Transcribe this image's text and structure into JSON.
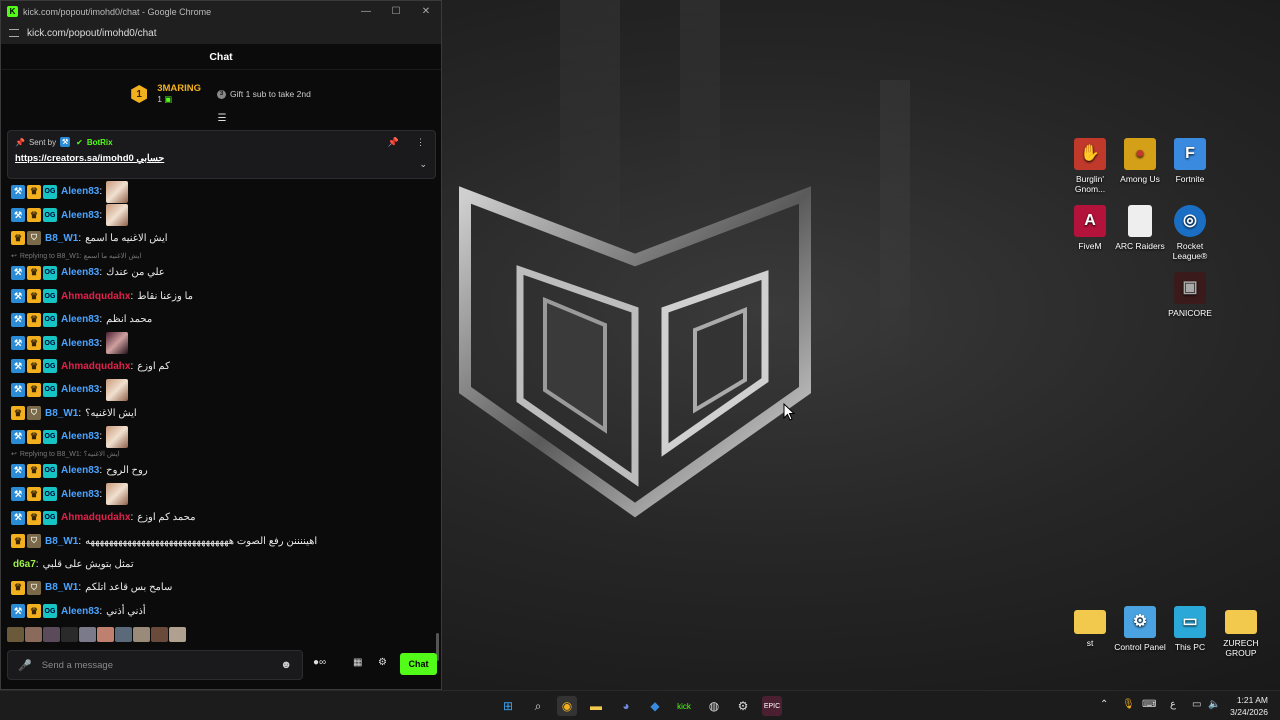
{
  "window": {
    "title": "kick.com/popout/imohd0/chat - Google Chrome",
    "url": "kick.com/popout/imohd0/chat",
    "minimize": "—",
    "maximize": "☐",
    "close": "✕"
  },
  "chat": {
    "header": "Chat",
    "leaderboard": {
      "rank": "1",
      "name": "3MARING",
      "count": "1",
      "gift_text": "Gift 1 sub to take 2nd"
    },
    "pinned": {
      "sent_by": "Sent by",
      "bot_name": "BotRix",
      "link": "https://creators.sa/imohd0 حسابي"
    },
    "messages": [
      {
        "user": "Aleen83",
        "color": "blue",
        "badges": [
          "mod",
          "crown",
          "og"
        ],
        "text": "",
        "emote": "light"
      },
      {
        "user": "Aleen83",
        "color": "blue",
        "badges": [
          "mod",
          "crown",
          "og"
        ],
        "text": "",
        "emote": "light"
      },
      {
        "user": "B8_W1",
        "color": "blue",
        "badges": [
          "crown",
          "shield"
        ],
        "text": "ايش الاغنيه ما اسمع"
      },
      {
        "reply": "Replying to B8_W1: ايش الاغنيه ما اسمع",
        "user": "Aleen83",
        "color": "blue",
        "badges": [
          "mod",
          "crown",
          "og"
        ],
        "text": "علي من عندك"
      },
      {
        "user": "Ahmadqudahx",
        "color": "red",
        "badges": [
          "mod",
          "crown",
          "og"
        ],
        "text": "ما وزعنا نقاط"
      },
      {
        "user": "Aleen83",
        "color": "blue",
        "badges": [
          "mod",
          "crown",
          "og"
        ],
        "text": "محمد انظم"
      },
      {
        "user": "Aleen83",
        "color": "blue",
        "badges": [
          "mod",
          "crown",
          "og"
        ],
        "text": "",
        "emote": "dark"
      },
      {
        "user": "Ahmadqudahx",
        "color": "red",
        "badges": [
          "mod",
          "crown",
          "og"
        ],
        "text": "كم اوزع"
      },
      {
        "user": "Aleen83",
        "color": "blue",
        "badges": [
          "mod",
          "crown",
          "og"
        ],
        "text": "",
        "emote": "light"
      },
      {
        "user": "B8_W1",
        "color": "blue",
        "badges": [
          "crown",
          "shield"
        ],
        "text": "ايش الاغنيه؟"
      },
      {
        "user": "Aleen83",
        "color": "blue",
        "badges": [
          "mod",
          "crown",
          "og"
        ],
        "text": "",
        "emote": "light"
      },
      {
        "reply": "Replying to B8_W1: ايش الاغنيه؟",
        "user": "Aleen83",
        "color": "blue",
        "badges": [
          "mod",
          "crown",
          "og"
        ],
        "text": "روح الروح"
      },
      {
        "user": "Aleen83",
        "color": "blue",
        "badges": [
          "mod",
          "crown",
          "og"
        ],
        "text": "",
        "emote": "light"
      },
      {
        "user": "Ahmadqudahx",
        "color": "red",
        "badges": [
          "mod",
          "crown",
          "og"
        ],
        "text": "محمد كم اوزع"
      },
      {
        "user": "B8_W1",
        "color": "blue",
        "badges": [
          "crown",
          "shield"
        ],
        "text": "اهيننننن رفع الصوت هههههههههههههههههههههههههههههههه"
      },
      {
        "user": "d6a7",
        "color": "green",
        "badges": [],
        "text": "تمثل بتويش على قلبي"
      },
      {
        "user": "B8_W1",
        "color": "blue",
        "badges": [
          "crown",
          "shield"
        ],
        "text": "سامح بس قاعد اتلكم"
      },
      {
        "user": "Aleen83",
        "color": "blue",
        "badges": [
          "mod",
          "crown",
          "og"
        ],
        "text": "أذني أذني"
      }
    ],
    "composer_placeholder": "Send a message",
    "send_label": "Chat"
  },
  "desktop_icons": [
    {
      "label": "Burglin' Gnom...",
      "glyph": "✋",
      "color": "#c0392b"
    },
    {
      "label": "Among Us",
      "glyph": "●",
      "color": "#d4a017"
    },
    {
      "label": "Fortnite",
      "glyph": "F",
      "color": "#3a8be0"
    },
    {
      "label": "FiveM",
      "glyph": "A",
      "color": "#b3123a"
    },
    {
      "label": "ARC Raiders",
      "glyph": "",
      "color": "#eeeeee"
    },
    {
      "label": "Rocket League®",
      "glyph": "◎",
      "color": "#1a6fc4"
    },
    {
      "label": "PANICORE",
      "glyph": "▣",
      "color": "#3a1a1a"
    },
    {
      "label": "st",
      "glyph": "",
      "color": "#f2c94c"
    },
    {
      "label": "Control Panel",
      "glyph": "⚙",
      "color": "#4aa3e0"
    },
    {
      "label": "This PC",
      "glyph": "▭",
      "color": "#2aa8d8"
    },
    {
      "label": "ZURECH GROUP",
      "glyph": "",
      "color": "#f2c94c"
    }
  ],
  "taskbar": {
    "time": "1:21 AM",
    "date": "3/24/2026",
    "lang": "ع"
  }
}
